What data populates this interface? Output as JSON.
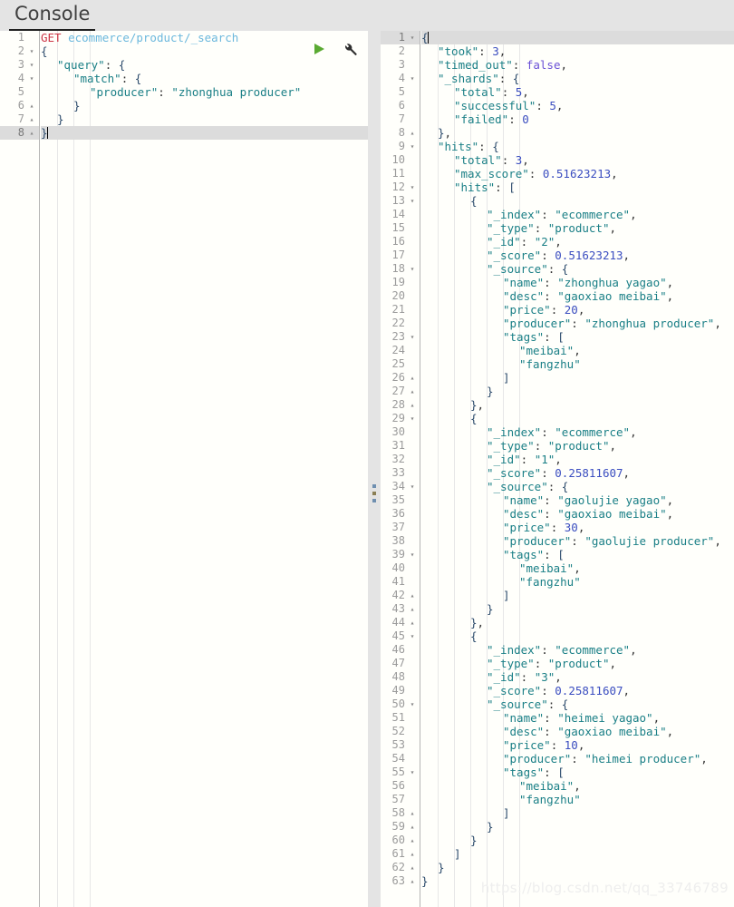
{
  "header": {
    "tabs": [
      {
        "label": "Console",
        "active": true
      }
    ]
  },
  "toolbar": {
    "run_icon": "play-icon",
    "settings_icon": "wrench-icon",
    "run_title": "Click to send request",
    "settings_title": "Settings"
  },
  "splitter": {
    "name": "pane-splitter",
    "grip_icon": "drag-handle-icon"
  },
  "watermark": {
    "text": "https://blog.csdn.net/qq_33746789"
  },
  "request_editor": {
    "name": "request-editor",
    "active_line": 8,
    "method": "GET",
    "path": "ecommerce/product/_search",
    "lines": [
      {
        "n": 1,
        "fold": "",
        "indent": 0,
        "text": "GET ecommerce/product/_search"
      },
      {
        "n": 2,
        "fold": "▾",
        "indent": 0,
        "text": "{"
      },
      {
        "n": 3,
        "fold": "▾",
        "indent": 1,
        "text": "\"query\": {"
      },
      {
        "n": 4,
        "fold": "▾",
        "indent": 2,
        "text": "\"match\": {"
      },
      {
        "n": 5,
        "fold": "",
        "indent": 3,
        "text": "\"producer\": \"zhonghua producer\""
      },
      {
        "n": 6,
        "fold": "▴",
        "indent": 2,
        "text": "}"
      },
      {
        "n": 7,
        "fold": "▴",
        "indent": 1,
        "text": "}"
      },
      {
        "n": 8,
        "fold": "▴",
        "indent": 0,
        "text": "}"
      }
    ],
    "body": {
      "query": {
        "match": {
          "producer": "zhonghua producer"
        }
      }
    }
  },
  "response_editor": {
    "name": "response-editor",
    "active_line": 1,
    "lines": [
      {
        "n": 1,
        "fold": "▾",
        "indent": 0,
        "text": "{"
      },
      {
        "n": 2,
        "fold": "",
        "indent": 1,
        "text": "\"took\": 3,"
      },
      {
        "n": 3,
        "fold": "",
        "indent": 1,
        "text": "\"timed_out\": false,"
      },
      {
        "n": 4,
        "fold": "▾",
        "indent": 1,
        "text": "\"_shards\": {"
      },
      {
        "n": 5,
        "fold": "",
        "indent": 2,
        "text": "\"total\": 5,"
      },
      {
        "n": 6,
        "fold": "",
        "indent": 2,
        "text": "\"successful\": 5,"
      },
      {
        "n": 7,
        "fold": "",
        "indent": 2,
        "text": "\"failed\": 0"
      },
      {
        "n": 8,
        "fold": "▴",
        "indent": 1,
        "text": "},"
      },
      {
        "n": 9,
        "fold": "▾",
        "indent": 1,
        "text": "\"hits\": {"
      },
      {
        "n": 10,
        "fold": "",
        "indent": 2,
        "text": "\"total\": 3,"
      },
      {
        "n": 11,
        "fold": "",
        "indent": 2,
        "text": "\"max_score\": 0.51623213,"
      },
      {
        "n": 12,
        "fold": "▾",
        "indent": 2,
        "text": "\"hits\": ["
      },
      {
        "n": 13,
        "fold": "▾",
        "indent": 3,
        "text": "{"
      },
      {
        "n": 14,
        "fold": "",
        "indent": 4,
        "text": "\"_index\": \"ecommerce\","
      },
      {
        "n": 15,
        "fold": "",
        "indent": 4,
        "text": "\"_type\": \"product\","
      },
      {
        "n": 16,
        "fold": "",
        "indent": 4,
        "text": "\"_id\": \"2\","
      },
      {
        "n": 17,
        "fold": "",
        "indent": 4,
        "text": "\"_score\": 0.51623213,"
      },
      {
        "n": 18,
        "fold": "▾",
        "indent": 4,
        "text": "\"_source\": {"
      },
      {
        "n": 19,
        "fold": "",
        "indent": 5,
        "text": "\"name\": \"zhonghua yagao\","
      },
      {
        "n": 20,
        "fold": "",
        "indent": 5,
        "text": "\"desc\": \"gaoxiao meibai\","
      },
      {
        "n": 21,
        "fold": "",
        "indent": 5,
        "text": "\"price\": 20,"
      },
      {
        "n": 22,
        "fold": "",
        "indent": 5,
        "text": "\"producer\": \"zhonghua producer\","
      },
      {
        "n": 23,
        "fold": "▾",
        "indent": 5,
        "text": "\"tags\": ["
      },
      {
        "n": 24,
        "fold": "",
        "indent": 6,
        "text": "\"meibai\","
      },
      {
        "n": 25,
        "fold": "",
        "indent": 6,
        "text": "\"fangzhu\""
      },
      {
        "n": 26,
        "fold": "▴",
        "indent": 5,
        "text": "]"
      },
      {
        "n": 27,
        "fold": "▴",
        "indent": 4,
        "text": "}"
      },
      {
        "n": 28,
        "fold": "▴",
        "indent": 3,
        "text": "},"
      },
      {
        "n": 29,
        "fold": "▾",
        "indent": 3,
        "text": "{"
      },
      {
        "n": 30,
        "fold": "",
        "indent": 4,
        "text": "\"_index\": \"ecommerce\","
      },
      {
        "n": 31,
        "fold": "",
        "indent": 4,
        "text": "\"_type\": \"product\","
      },
      {
        "n": 32,
        "fold": "",
        "indent": 4,
        "text": "\"_id\": \"1\","
      },
      {
        "n": 33,
        "fold": "",
        "indent": 4,
        "text": "\"_score\": 0.25811607,"
      },
      {
        "n": 34,
        "fold": "▾",
        "indent": 4,
        "text": "\"_source\": {"
      },
      {
        "n": 35,
        "fold": "",
        "indent": 5,
        "text": "\"name\": \"gaolujie yagao\","
      },
      {
        "n": 36,
        "fold": "",
        "indent": 5,
        "text": "\"desc\": \"gaoxiao meibai\","
      },
      {
        "n": 37,
        "fold": "",
        "indent": 5,
        "text": "\"price\": 30,"
      },
      {
        "n": 38,
        "fold": "",
        "indent": 5,
        "text": "\"producer\": \"gaolujie producer\","
      },
      {
        "n": 39,
        "fold": "▾",
        "indent": 5,
        "text": "\"tags\": ["
      },
      {
        "n": 40,
        "fold": "",
        "indent": 6,
        "text": "\"meibai\","
      },
      {
        "n": 41,
        "fold": "",
        "indent": 6,
        "text": "\"fangzhu\""
      },
      {
        "n": 42,
        "fold": "▴",
        "indent": 5,
        "text": "]"
      },
      {
        "n": 43,
        "fold": "▴",
        "indent": 4,
        "text": "}"
      },
      {
        "n": 44,
        "fold": "▴",
        "indent": 3,
        "text": "},"
      },
      {
        "n": 45,
        "fold": "▾",
        "indent": 3,
        "text": "{"
      },
      {
        "n": 46,
        "fold": "",
        "indent": 4,
        "text": "\"_index\": \"ecommerce\","
      },
      {
        "n": 47,
        "fold": "",
        "indent": 4,
        "text": "\"_type\": \"product\","
      },
      {
        "n": 48,
        "fold": "",
        "indent": 4,
        "text": "\"_id\": \"3\","
      },
      {
        "n": 49,
        "fold": "",
        "indent": 4,
        "text": "\"_score\": 0.25811607,"
      },
      {
        "n": 50,
        "fold": "▾",
        "indent": 4,
        "text": "\"_source\": {"
      },
      {
        "n": 51,
        "fold": "",
        "indent": 5,
        "text": "\"name\": \"heimei yagao\","
      },
      {
        "n": 52,
        "fold": "",
        "indent": 5,
        "text": "\"desc\": \"gaoxiao meibai\","
      },
      {
        "n": 53,
        "fold": "",
        "indent": 5,
        "text": "\"price\": 10,"
      },
      {
        "n": 54,
        "fold": "",
        "indent": 5,
        "text": "\"producer\": \"heimei producer\","
      },
      {
        "n": 55,
        "fold": "▾",
        "indent": 5,
        "text": "\"tags\": ["
      },
      {
        "n": 56,
        "fold": "",
        "indent": 6,
        "text": "\"meibai\","
      },
      {
        "n": 57,
        "fold": "",
        "indent": 6,
        "text": "\"fangzhu\""
      },
      {
        "n": 58,
        "fold": "▴",
        "indent": 5,
        "text": "]"
      },
      {
        "n": 59,
        "fold": "▴",
        "indent": 4,
        "text": "}"
      },
      {
        "n": 60,
        "fold": "▴",
        "indent": 3,
        "text": "}"
      },
      {
        "n": 61,
        "fold": "▴",
        "indent": 2,
        "text": "]"
      },
      {
        "n": 62,
        "fold": "▴",
        "indent": 1,
        "text": "}"
      },
      {
        "n": 63,
        "fold": "▴",
        "indent": 0,
        "text": "}"
      }
    ],
    "body": {
      "took": 3,
      "timed_out": false,
      "_shards": {
        "total": 5,
        "successful": 5,
        "failed": 0
      },
      "hits": {
        "total": 3,
        "max_score": 0.51623213,
        "hits": [
          {
            "_index": "ecommerce",
            "_type": "product",
            "_id": "2",
            "_score": 0.51623213,
            "_source": {
              "name": "zhonghua yagao",
              "desc": "gaoxiao meibai",
              "price": 20,
              "producer": "zhonghua producer",
              "tags": [
                "meibai",
                "fangzhu"
              ]
            }
          },
          {
            "_index": "ecommerce",
            "_type": "product",
            "_id": "1",
            "_score": 0.25811607,
            "_source": {
              "name": "gaolujie yagao",
              "desc": "gaoxiao meibai",
              "price": 30,
              "producer": "gaolujie producer",
              "tags": [
                "meibai",
                "fangzhu"
              ]
            }
          },
          {
            "_index": "ecommerce",
            "_type": "product",
            "_id": "3",
            "_score": 0.25811607,
            "_source": {
              "name": "heimei yagao",
              "desc": "gaoxiao meibai",
              "price": 10,
              "producer": "heimei producer",
              "tags": [
                "meibai",
                "fangzhu"
              ]
            }
          }
        ]
      }
    }
  },
  "colors": {
    "chrome_bg": "#e4e4e4",
    "editor_bg": "#fffffb",
    "active_line": "#dcdcdc",
    "gutter_text": "#9b9b9b",
    "method": "#cc3344",
    "url": "#6cb8dd",
    "key": "#1a7f86",
    "string": "#1a7f86",
    "number": "#3b4ec0",
    "boolean": "#6a50d6",
    "run_icon": "#5aaa32",
    "watermark": "#eeeeee"
  }
}
